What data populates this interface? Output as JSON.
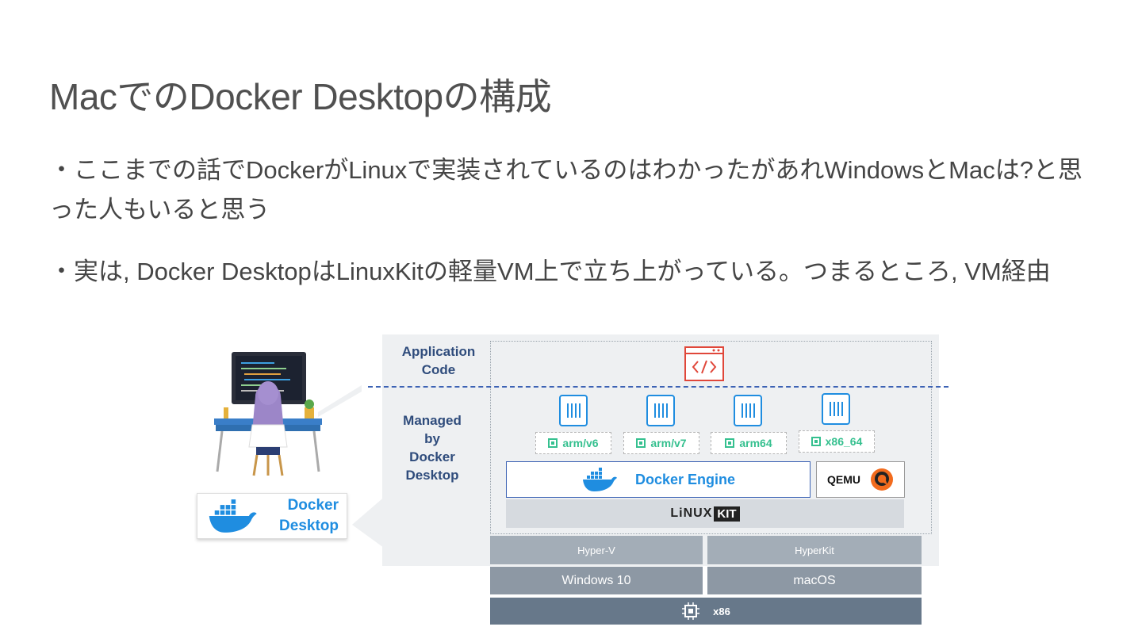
{
  "slide": {
    "title": "MacでのDocker Desktopの構成",
    "bullets": [
      "・ここまでの話でDockerがLinuxで実装されているのはわかったがあれWindowsとMacは?と思った人もいると思う",
      "・実は, Docker DesktopはLinuxKitの軽量VM上で立ち上がっている。つまるところ, VM経由"
    ]
  },
  "diagram": {
    "app_label_line1": "Application",
    "app_label_line2": "Code",
    "managed_line1": "Managed",
    "managed_line2": "by",
    "managed_line3": "Docker",
    "managed_line4": "Desktop",
    "architectures": [
      "arm/v6",
      "arm/v7",
      "arm64",
      "x86_64"
    ],
    "docker_engine": "Docker Engine",
    "qemu": "QEMU",
    "linuxkit_a": "LiNUX",
    "linuxkit_b": "KIT",
    "hypervisors": [
      "Hyper-V",
      "HyperKit"
    ],
    "oses": [
      "Windows 10",
      "macOS"
    ],
    "cpu": "x86",
    "docker_desktop_line1": "Docker",
    "docker_desktop_line2": "Desktop"
  },
  "colors": {
    "docker_blue": "#1f8de0",
    "arch_green": "#35c08f",
    "code_red": "#e0473a",
    "label_navy": "#2f4c7c",
    "panel_gray": "#eef0f2",
    "hypervisor": "#a3adb7",
    "os": "#8d98a4",
    "cpu_bar": "#67788a"
  },
  "icons": [
    "developer-illustration",
    "code-window-icon",
    "container-icon",
    "chip-icon",
    "docker-whale-icon",
    "qemu-logo-icon",
    "cpu-icon"
  ]
}
